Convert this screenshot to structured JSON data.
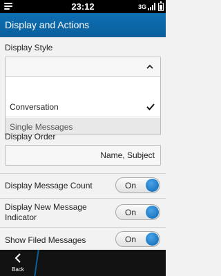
{
  "status_bar": {
    "time": "23:12",
    "network": "3G",
    "icons": [
      "menu-icon",
      "signal-icon",
      "battery-icon"
    ]
  },
  "header": {
    "title": "Display and Actions"
  },
  "display_style": {
    "label": "Display Style",
    "selected_value": "",
    "options": [
      {
        "label": "Conversation",
        "selected": true
      },
      {
        "label": "Single Messages",
        "selected": false
      }
    ]
  },
  "display_order": {
    "label": "Display Order",
    "value": "Name, Subject"
  },
  "settings": [
    {
      "label": "Display Message Count",
      "state": "On"
    },
    {
      "label": "Display New Message Indicator",
      "state": "On"
    },
    {
      "label": "Show Filed Messages",
      "state": "On"
    }
  ],
  "bottom_bar": {
    "back_label": "Back"
  },
  "colors": {
    "accent": "#0a67b0",
    "title_bar": "#0e6fb3",
    "status_bar": "#000000",
    "bottom_bar": "#121212"
  }
}
